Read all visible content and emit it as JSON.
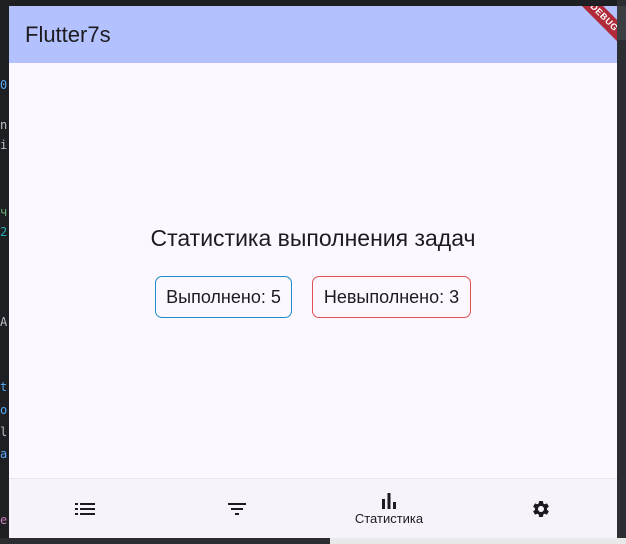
{
  "app": {
    "title": "Flutter7s",
    "debug_banner": "DEBUG"
  },
  "stats": {
    "heading": "Статистика выполнения задач",
    "completed_label": "Выполнено: 5",
    "not_completed_label": "Невыполнено: 3",
    "completed": 5,
    "not_completed": 3
  },
  "bottom_nav": {
    "items": [
      {
        "icon": "list-icon",
        "label": ""
      },
      {
        "icon": "filter-icon",
        "label": ""
      },
      {
        "icon": "bar-chart-icon",
        "label": "Статистика",
        "selected": true
      },
      {
        "icon": "gear-icon",
        "label": ""
      }
    ]
  },
  "colors": {
    "appbar": "#b3c2fe",
    "background": "#fdf7ff",
    "completed_border": "#1a8fc9",
    "not_completed_border": "#e05252",
    "debug_banner": "#b02a39"
  }
}
